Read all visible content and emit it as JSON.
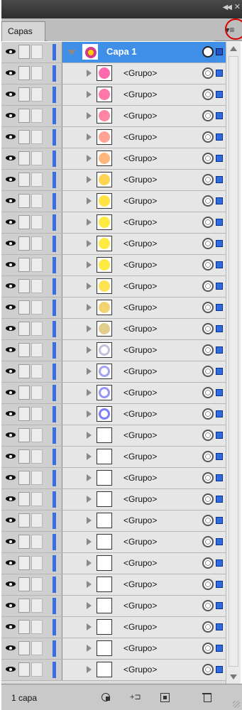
{
  "panel": {
    "tab_label": "Capas",
    "menu_icon": "panel-menu-icon",
    "collapse_icon": "double-chevron-icon",
    "close_icon": "close-icon"
  },
  "colors": {
    "layer_color": "#3a6fe0",
    "selected_row": "#3f8ee8",
    "callout_red": "#d40000"
  },
  "header_layer": {
    "name": "Capa 1",
    "expanded": true,
    "thumb_color": "#d43a8c"
  },
  "rows": [
    {
      "label": "<Grupo>",
      "thumb_color": "#ff5aa5"
    },
    {
      "label": "<Grupo>",
      "thumb_color": "#ff6aa0"
    },
    {
      "label": "<Grupo>",
      "thumb_color": "#ff7a9a"
    },
    {
      "label": "<Grupo>",
      "thumb_color": "#ff9a8a"
    },
    {
      "label": "<Grupo>",
      "thumb_color": "#ffb070"
    },
    {
      "label": "<Grupo>",
      "thumb_color": "#ffd040"
    },
    {
      "label": "<Grupo>",
      "thumb_color": "#ffe030"
    },
    {
      "label": "<Grupo>",
      "thumb_color": "#ffe830"
    },
    {
      "label": "<Grupo>",
      "thumb_color": "#ffe830"
    },
    {
      "label": "<Grupo>",
      "thumb_color": "#ffe830"
    },
    {
      "label": "<Grupo>",
      "thumb_color": "#ffe040"
    },
    {
      "label": "<Grupo>",
      "thumb_color": "#f0d060"
    },
    {
      "label": "<Grupo>",
      "thumb_color": "#e0c880"
    },
    {
      "label": "<Grupo>",
      "thumb_color": "#c0b8d8"
    },
    {
      "label": "<Grupo>",
      "thumb_color": "#9a9af0"
    },
    {
      "label": "<Grupo>",
      "thumb_color": "#8a8af8"
    },
    {
      "label": "<Grupo>",
      "thumb_color": "#7070ff"
    },
    {
      "label": "<Grupo>",
      "thumb_color": ""
    },
    {
      "label": "<Grupo>",
      "thumb_color": ""
    },
    {
      "label": "<Grupo>",
      "thumb_color": ""
    },
    {
      "label": "<Grupo>",
      "thumb_color": ""
    },
    {
      "label": "<Grupo>",
      "thumb_color": ""
    },
    {
      "label": "<Grupo>",
      "thumb_color": ""
    },
    {
      "label": "<Grupo>",
      "thumb_color": ""
    },
    {
      "label": "<Grupo>",
      "thumb_color": ""
    },
    {
      "label": "<Grupo>",
      "thumb_color": ""
    },
    {
      "label": "<Grupo>",
      "thumb_color": ""
    },
    {
      "label": "<Grupo>",
      "thumb_color": ""
    },
    {
      "label": "<Grupo>",
      "thumb_color": ""
    }
  ],
  "footer": {
    "count_label": "1 capa",
    "icons": [
      "make-clipping-mask-icon",
      "create-sublayer-icon",
      "new-layer-icon",
      "trash-icon"
    ]
  }
}
